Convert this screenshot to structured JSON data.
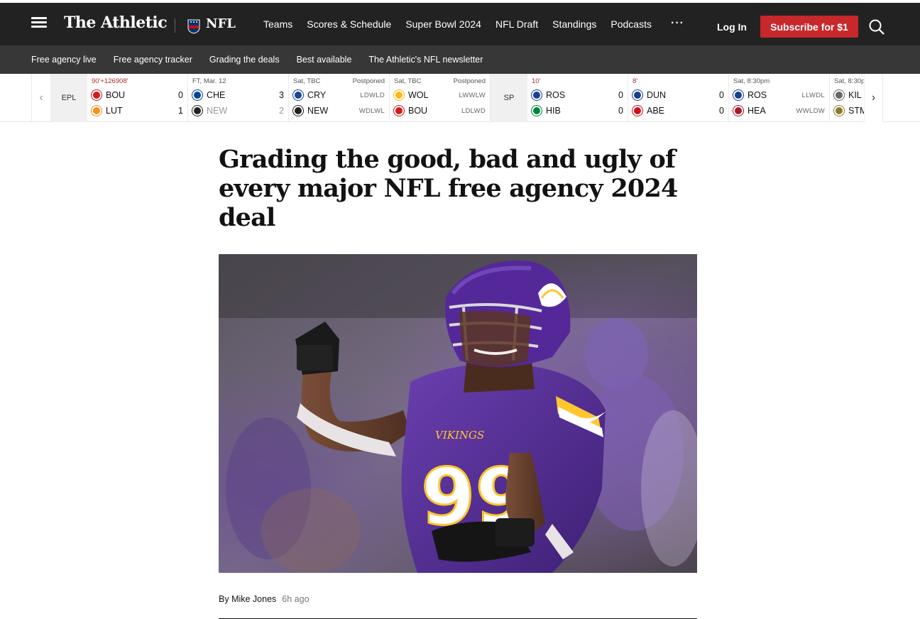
{
  "header": {
    "brand": "The Athletic",
    "section": "NFL",
    "nav": [
      "Teams",
      "Scores & Schedule",
      "Super Bowl 2024",
      "NFL Draft",
      "Standings",
      "Podcasts"
    ],
    "more": "···",
    "login": "Log In",
    "subscribe": "Subscribe for $1"
  },
  "subnav": [
    "Free agency live",
    "Free agency tracker",
    "Grading the deals",
    "Best available",
    "The Athletic's NFL newsletter"
  ],
  "scores": {
    "leagues": [
      "EPL",
      "SP"
    ],
    "games": [
      {
        "status": "90'+126908'",
        "status_right": "",
        "live": true,
        "home": {
          "abbr": "BOU",
          "score": "0",
          "form": "",
          "color": "#d71920",
          "dim": false
        },
        "away": {
          "abbr": "LUT",
          "score": "1",
          "form": "",
          "color": "#f78f1e",
          "dim": false
        }
      },
      {
        "status": "FT, Mar. 12",
        "status_right": "",
        "live": false,
        "home": {
          "abbr": "CHE",
          "score": "3",
          "form": "",
          "color": "#034694",
          "dim": false
        },
        "away": {
          "abbr": "NEW",
          "score": "2",
          "form": "",
          "color": "#241f20",
          "dim": true
        }
      },
      {
        "status": "Sat, TBC",
        "status_right": "Postponed",
        "live": false,
        "home": {
          "abbr": "CRY",
          "score": "",
          "form": "LDWLD",
          "color": "#1b458f",
          "dim": false
        },
        "away": {
          "abbr": "NEW",
          "score": "",
          "form": "WDLWL",
          "color": "#241f20",
          "dim": false
        }
      },
      {
        "status": "Sat, TBC",
        "status_right": "Postponed",
        "live": false,
        "home": {
          "abbr": "WOL",
          "score": "",
          "form": "LWWLW",
          "color": "#fdb913",
          "dim": false
        },
        "away": {
          "abbr": "BOU",
          "score": "",
          "form": "LDLWD",
          "color": "#d71920",
          "dim": false
        }
      },
      {
        "status": "10'",
        "status_right": "",
        "live": true,
        "home": {
          "abbr": "ROS",
          "score": "0",
          "form": "",
          "color": "#1c3f94",
          "dim": false
        },
        "away": {
          "abbr": "HIB",
          "score": "0",
          "form": "",
          "color": "#00853f",
          "dim": false
        }
      },
      {
        "status": "8'",
        "status_right": "",
        "live": true,
        "home": {
          "abbr": "DUN",
          "score": "0",
          "form": "",
          "color": "#1b3d8f",
          "dim": false
        },
        "away": {
          "abbr": "ABE",
          "score": "0",
          "form": "",
          "color": "#d0111a",
          "dim": false
        }
      },
      {
        "status": "Sat, 8:30pm",
        "status_right": "",
        "live": false,
        "home": {
          "abbr": "ROS",
          "score": "",
          "form": "LLWDL",
          "color": "#1c3f94",
          "dim": false
        },
        "away": {
          "abbr": "HEA",
          "score": "",
          "form": "WWLDW",
          "color": "#a6192e",
          "dim": false
        }
      },
      {
        "status": "Sat, 8:30p",
        "status_right": "",
        "live": false,
        "home": {
          "abbr": "KIL",
          "score": "",
          "form": "",
          "color": "#666666",
          "dim": false
        },
        "away": {
          "abbr": "STM",
          "score": "",
          "form": "",
          "color": "#8a7a2a",
          "dim": false
        }
      }
    ]
  },
  "article": {
    "headline": "Grading the good, bad and ugly of every major NFL free agency 2024 deal",
    "byline_prefix": "By ",
    "author": "Mike Jones",
    "time": "6h ago"
  },
  "colors": {
    "nav_bg": "#222222",
    "subnav_bg": "#373737",
    "subscribe": "#c6282b",
    "vikings_purple": "#4f2683",
    "vikings_gold": "#ffc62f"
  }
}
